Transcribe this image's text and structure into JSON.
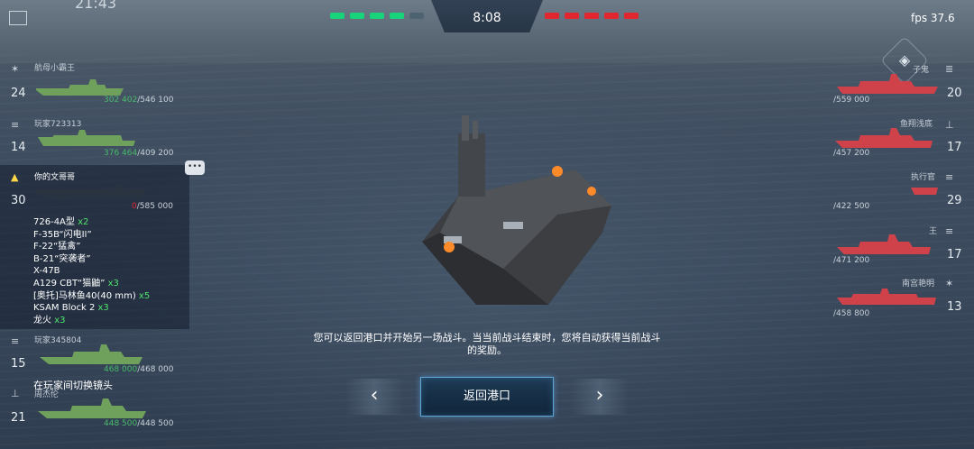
{
  "hud": {
    "clock": "21:43",
    "timer": "8:08",
    "fps": "fps 37.6"
  },
  "allies": [
    {
      "name": "航母小霸王",
      "level": "24",
      "health": "302 402",
      "max": "/546 100"
    },
    {
      "name": "玩家723313",
      "level": "14",
      "health": "376 464",
      "max": "/409 200"
    },
    {
      "name": "你的文哥哥",
      "level": "30",
      "health": "0",
      "max": "/585 000"
    },
    {
      "name": "玩家345804",
      "level": "15",
      "health": "468 000",
      "max": "/468 000"
    },
    {
      "name": "周杰伦",
      "level": "21",
      "health": "448 500",
      "max": "/448 500"
    }
  ],
  "enemies": [
    {
      "name": "子鬼",
      "level": "20",
      "health": "",
      "max": "/559 000"
    },
    {
      "name": "鱼翔浅底",
      "level": "17",
      "health": "",
      "max": "/457 200"
    },
    {
      "name": "执行官",
      "level": "29",
      "health": "",
      "max": "/422 500"
    },
    {
      "name": "王",
      "level": "17",
      "health": "",
      "max": "/471 200"
    },
    {
      "name": "南宫艳明",
      "level": "13",
      "health": "",
      "max": "/458 800"
    }
  ],
  "weapons": [
    {
      "name": "726-4A型",
      "count": "x2"
    },
    {
      "name": "F-35B“闪电II”",
      "count": ""
    },
    {
      "name": "F-22“猛禽”",
      "count": ""
    },
    {
      "name": "B-21“突袭者”",
      "count": ""
    },
    {
      "name": "X-47B",
      "count": ""
    },
    {
      "name": "A129 CBT“猫鼬”",
      "count": "x3"
    },
    {
      "name": "[奥托]马林鱼40(40 mm)",
      "count": "x5"
    },
    {
      "name": "KSAM Block 2",
      "count": "x3"
    },
    {
      "name": "龙火",
      "count": "x3"
    }
  ],
  "message": "您可以返回港口并开始另一场战斗。当当前战斗结束时，您将自动获得当前战斗的奖励。",
  "buttons": {
    "return_port": "返回港口",
    "prev": "‹",
    "next": "›"
  },
  "switch_camera": "在玩家间切换镜头",
  "colors": {
    "ally": "#5fa05a",
    "enemy": "#d0424a",
    "ally_health_text": "#49b96a",
    "enemy_health_text": "#c24449",
    "highlight": "#5fa6d6"
  },
  "icons": {
    "fullscreen": "fullscreen-icon",
    "radar": "radar-icon",
    "chat": "chat-icon"
  }
}
